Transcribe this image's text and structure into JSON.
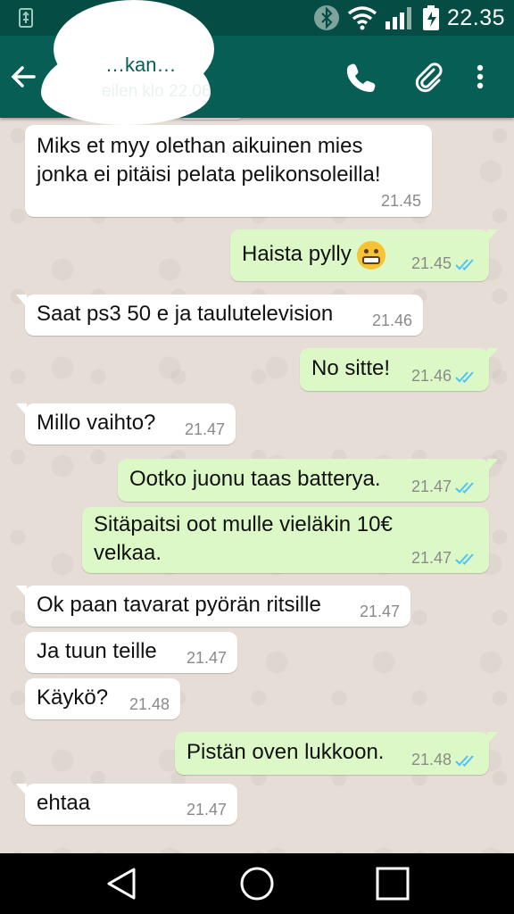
{
  "status_bar": {
    "time": "22.35",
    "icons": [
      "usb-icon",
      "bluetooth-icon",
      "wifi-icon",
      "signal-icon",
      "battery-icon"
    ]
  },
  "header": {
    "contact_name": "…kan…",
    "last_seen": "eilen klo 22.06",
    "actions": [
      "call-icon",
      "attach-icon",
      "more-icon"
    ]
  },
  "messages": [
    {
      "dir": "in",
      "lines": [
        "Miks et myy olethan aikuinen mies",
        "jonka ei pitäisi pelata pelikonsoleilla!"
      ],
      "time": "21.45"
    },
    {
      "dir": "out",
      "lines": [
        "Haista pylly"
      ],
      "emoji": "grimacing-face",
      "time": "21.45"
    },
    {
      "dir": "in",
      "lines": [
        "Saat ps3 50 e ja taulutelevision"
      ],
      "time": "21.46"
    },
    {
      "dir": "out",
      "lines": [
        "No sitte!"
      ],
      "time": "21.46"
    },
    {
      "dir": "in",
      "lines": [
        "Millo vaihto?"
      ],
      "time": "21.47"
    },
    {
      "dir": "out",
      "lines": [
        "Ootko juonu taas batterya."
      ],
      "time": "21.47"
    },
    {
      "dir": "out",
      "lines": [
        "Sitäpaitsi oot mulle vieläkin 10€",
        "velkaa."
      ],
      "time": "21.47"
    },
    {
      "dir": "in",
      "lines": [
        "Ok paan tavarat pyörän ritsille"
      ],
      "time": "21.47"
    },
    {
      "dir": "in",
      "lines": [
        "Ja tuun teille"
      ],
      "time": "21.47"
    },
    {
      "dir": "in",
      "lines": [
        "Käykö?"
      ],
      "time": "21.48"
    },
    {
      "dir": "out",
      "lines": [
        "Pistän oven lukkoon."
      ],
      "time": "21.48"
    },
    {
      "dir": "in",
      "lines": [
        "ehtaa"
      ],
      "time": "21.47"
    }
  ],
  "colors": {
    "status_bar": "#054d44",
    "app_bar": "#075e54",
    "chat_background": "#e6ded6",
    "incoming_bubble": "#ffffff",
    "outgoing_bubble": "#dcf8c6",
    "read_check": "#4fc3f7"
  },
  "nav_bar": {
    "buttons": [
      "back-triangle-icon",
      "home-circle-icon",
      "recents-square-icon"
    ]
  }
}
